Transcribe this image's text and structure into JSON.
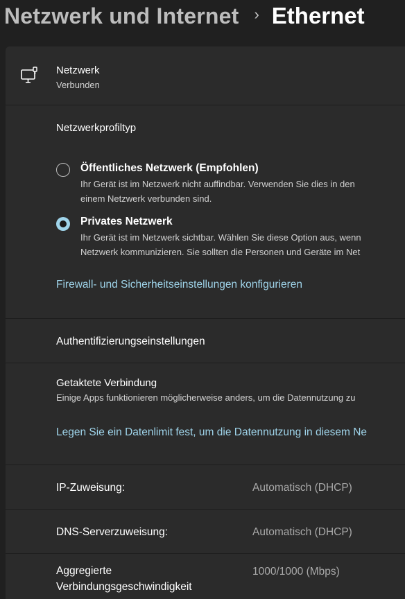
{
  "breadcrumb": {
    "parent": "Netzwerk und Internet",
    "separator": "›",
    "current": "Ethernet"
  },
  "network": {
    "icon": "ethernet-monitor-icon",
    "name": "Netzwerk",
    "status": "Verbunden"
  },
  "profile": {
    "heading": "Netzwerkprofiltyp",
    "options": [
      {
        "title": "Öffentliches Netzwerk (Empfohlen)",
        "desc_line1": "Ihr Gerät ist im Netzwerk nicht auffindbar. Verwenden Sie dies in den",
        "desc_line2": "einem Netzwerk verbunden sind.",
        "selected": false
      },
      {
        "title": "Privates Netzwerk",
        "desc_line1": "Ihr Gerät ist im Netzwerk sichtbar. Wählen Sie diese Option aus, wenn",
        "desc_line2": "Netzwerk kommunizieren. Sie sollten die Personen und Geräte im Net",
        "selected": true
      }
    ],
    "firewall_link": "Firewall- und Sicherheitseinstellungen konfigurieren"
  },
  "auth": {
    "label": "Authentifizierungseinstellungen"
  },
  "metered": {
    "title": "Getaktete Verbindung",
    "desc": "Einige Apps funktionieren möglicherweise anders, um die Datennutzung zu",
    "link": "Legen Sie ein Datenlimit fest, um die Datennutzung in diesem Ne"
  },
  "properties": [
    {
      "label": "IP-Zuweisung:",
      "value": "Automatisch (DHCP)"
    },
    {
      "label": "DNS-Serverzuweisung:",
      "value": "Automatisch (DHCP)"
    },
    {
      "label_line1": "Aggregierte",
      "label_line2": "Verbindungsgeschwindigkeit",
      "value": "1000/1000 (Mbps)"
    }
  ],
  "colors": {
    "background": "#202020",
    "card": "#2b2b2b",
    "accent": "#9fd4ea"
  }
}
